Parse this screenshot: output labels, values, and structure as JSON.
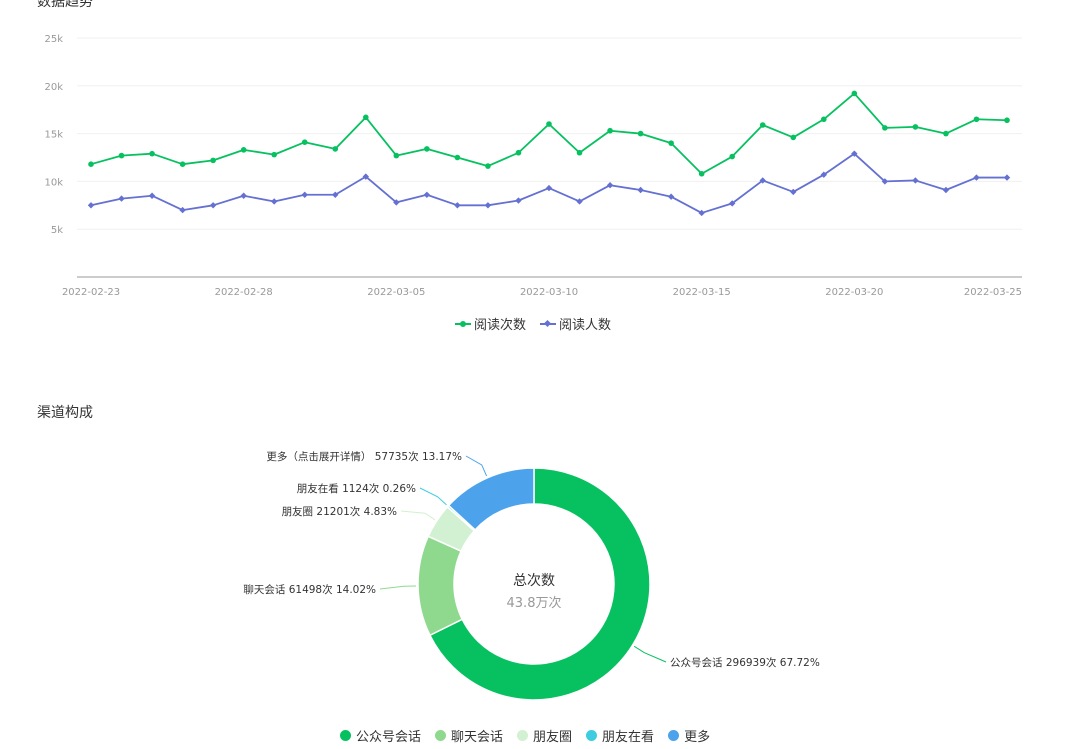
{
  "chart_data": [
    {
      "type": "line",
      "title": "数据趋势",
      "x": [
        "2022-02-23",
        "2022-02-24",
        "2022-02-25",
        "2022-02-26",
        "2022-02-27",
        "2022-02-28",
        "2022-03-01",
        "2022-03-02",
        "2022-03-03",
        "2022-03-04",
        "2022-03-05",
        "2022-03-06",
        "2022-03-07",
        "2022-03-08",
        "2022-03-09",
        "2022-03-10",
        "2022-03-11",
        "2022-03-12",
        "2022-03-13",
        "2022-03-14",
        "2022-03-15",
        "2022-03-16",
        "2022-03-17",
        "2022-03-18",
        "2022-03-19",
        "2022-03-20",
        "2022-03-21",
        "2022-03-22",
        "2022-03-23",
        "2022-03-24",
        "2022-03-25"
      ],
      "x_tick_labels": [
        "2022-02-23",
        "2022-02-28",
        "2022-03-05",
        "2022-03-10",
        "2022-03-15",
        "2022-03-20",
        "2022-03-25"
      ],
      "y_tick_labels": [
        "5k",
        "10k",
        "15k",
        "20k",
        "25k"
      ],
      "ylim": [
        0,
        25000
      ],
      "grid": true,
      "legend_position": "bottom-center",
      "series": [
        {
          "name": "阅读次数",
          "color": "#07c160",
          "marker": "circle",
          "values": [
            11800,
            12700,
            12900,
            11800,
            12200,
            13300,
            12800,
            14100,
            13400,
            16700,
            12700,
            13400,
            12500,
            11600,
            13000,
            16000,
            13000,
            15300,
            15000,
            14000,
            10800,
            12600,
            15900,
            14600,
            16500,
            19200,
            15600,
            15700,
            15000,
            16500,
            16400
          ]
        },
        {
          "name": "阅读人数",
          "color": "#6470d2",
          "marker": "diamond",
          "values": [
            7500,
            8200,
            8500,
            7000,
            7500,
            8500,
            7900,
            8600,
            8600,
            10500,
            7800,
            8600,
            7500,
            7500,
            8000,
            9300,
            7900,
            9600,
            9100,
            8400,
            6700,
            7700,
            10100,
            8900,
            10700,
            12900,
            10000,
            10100,
            9100,
            10400,
            10400
          ]
        }
      ]
    },
    {
      "type": "pie",
      "title": "渠道构成",
      "center_title": "总次数",
      "center_value": "43.8万次",
      "legend_position": "bottom-center",
      "slices": [
        {
          "name": "公众号会话",
          "label": "公众号会话 296939次 67.72%",
          "value": 296939,
          "percent": 67.72,
          "color": "#07c160"
        },
        {
          "name": "聊天会话",
          "label": "聊天会话 61498次 14.02%",
          "value": 61498,
          "percent": 14.02,
          "color": "#8fd98f"
        },
        {
          "name": "朋友圈",
          "label": "朋友圈 21201次 4.83%",
          "value": 21201,
          "percent": 4.83,
          "color": "#d2f0d2"
        },
        {
          "name": "朋友在看",
          "label": "朋友在看 1124次 0.26%",
          "value": 1124,
          "percent": 0.26,
          "color": "#3ecde0"
        },
        {
          "name": "更多",
          "label": "更多（点击展开详情） 57735次 13.17%",
          "value": 57735,
          "percent": 13.17,
          "color": "#4ca3ec"
        }
      ]
    }
  ],
  "colors": {
    "axis": "#cccccc",
    "grid": "#f0f0f0",
    "tick_text": "#999999"
  }
}
